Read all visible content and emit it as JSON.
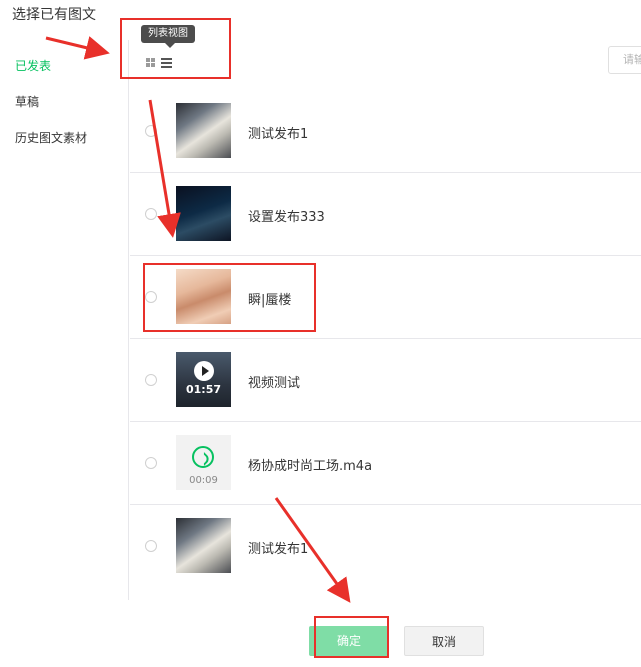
{
  "dialog": {
    "title": "选择已有图文"
  },
  "sidebar": {
    "items": [
      {
        "label": "已发表",
        "active": true
      },
      {
        "label": "草稿",
        "active": false
      },
      {
        "label": "历史图文素材",
        "active": false
      }
    ]
  },
  "toolbar": {
    "tooltip": "列表视图",
    "search_placeholder": "请输"
  },
  "items": [
    {
      "title": "测试发布1",
      "thumb": "newspaper-image"
    },
    {
      "title": "设置发布333",
      "thumb": "night-scene-image"
    },
    {
      "title": "瞬|蜃楼",
      "thumb": "desert-image"
    },
    {
      "title": "视频测试",
      "thumb": "video-thumbnail",
      "duration": "01:57"
    },
    {
      "title": "杨协成时尚工场.m4a",
      "thumb": "audio-thumbnail",
      "duration": "00:09"
    },
    {
      "title": "测试发布1",
      "thumb": "newspaper-image"
    }
  ],
  "buttons": {
    "confirm": "确定",
    "cancel": "取消"
  },
  "colors": {
    "accent": "#07c160",
    "annotation": "#e8302a",
    "confirm_disabled": "#7fdda6"
  }
}
